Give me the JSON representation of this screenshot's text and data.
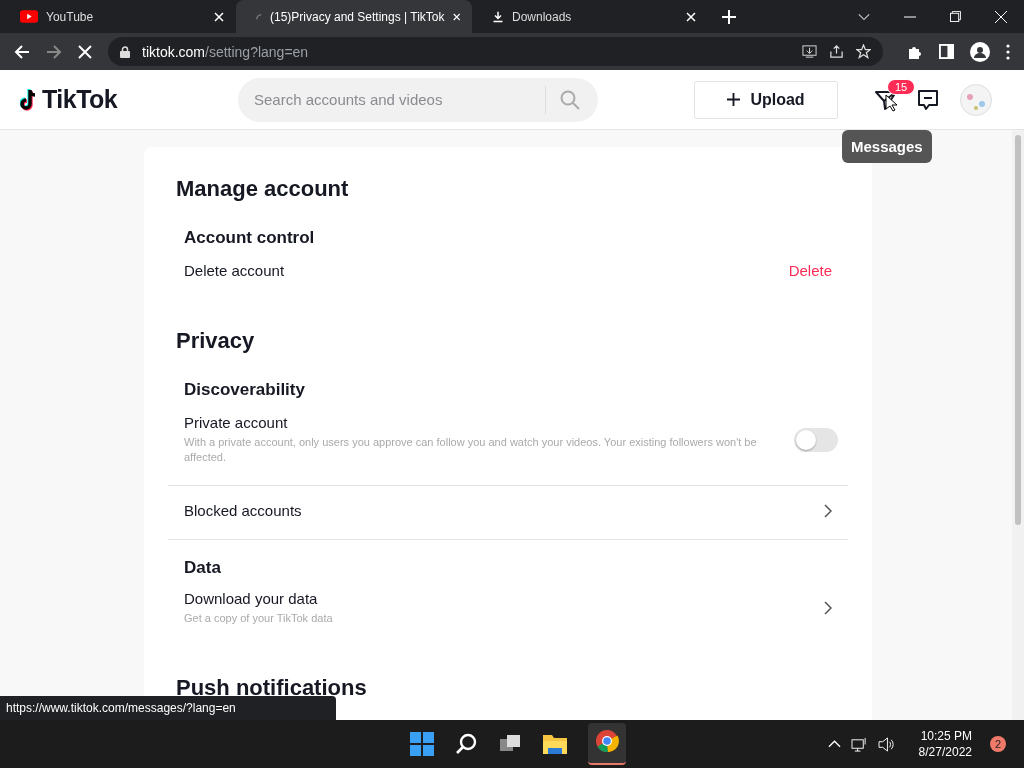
{
  "browser": {
    "tabs": [
      {
        "title": "YouTube",
        "kind": "youtube",
        "selected": false
      },
      {
        "title": "(15)Privacy and Settings | TikTok",
        "kind": "loading",
        "selected": true
      },
      {
        "title": "Downloads",
        "kind": "download",
        "selected": false
      }
    ],
    "address": {
      "domain": "tiktok.com",
      "path": "/setting?lang=en"
    },
    "loading": true
  },
  "header": {
    "logo": "TikTok",
    "search": {
      "placeholder": "Search accounts and videos"
    },
    "upload": "Upload",
    "inbox_badge": "15",
    "tooltip": "Messages"
  },
  "sections": [
    {
      "title": "Manage account",
      "groups": [
        {
          "heading": "Account control",
          "rows": [
            {
              "kind": "action",
              "label": "Delete account",
              "action": "Delete"
            }
          ]
        }
      ]
    },
    {
      "title": "Privacy",
      "groups": [
        {
          "heading": "Discoverability",
          "rows": [
            {
              "kind": "toggle",
              "label": "Private account",
              "description": "With a private account, only users you approve can follow you and watch your videos. Your existing followers won't be affected.",
              "on": false
            }
          ]
        },
        {
          "rows": [
            {
              "kind": "link",
              "label": "Blocked accounts"
            }
          ]
        },
        {
          "heading": "Data",
          "rows": [
            {
              "kind": "link",
              "label": "Download your data",
              "description": "Get a copy of your TikTok data"
            }
          ]
        }
      ]
    },
    {
      "title": "Push notifications"
    }
  ],
  "status_url": "https://www.tiktok.com/messages/?lang=en",
  "taskbar": {
    "time": "10:25 PM",
    "date": "8/27/2022",
    "notifications": "2"
  }
}
